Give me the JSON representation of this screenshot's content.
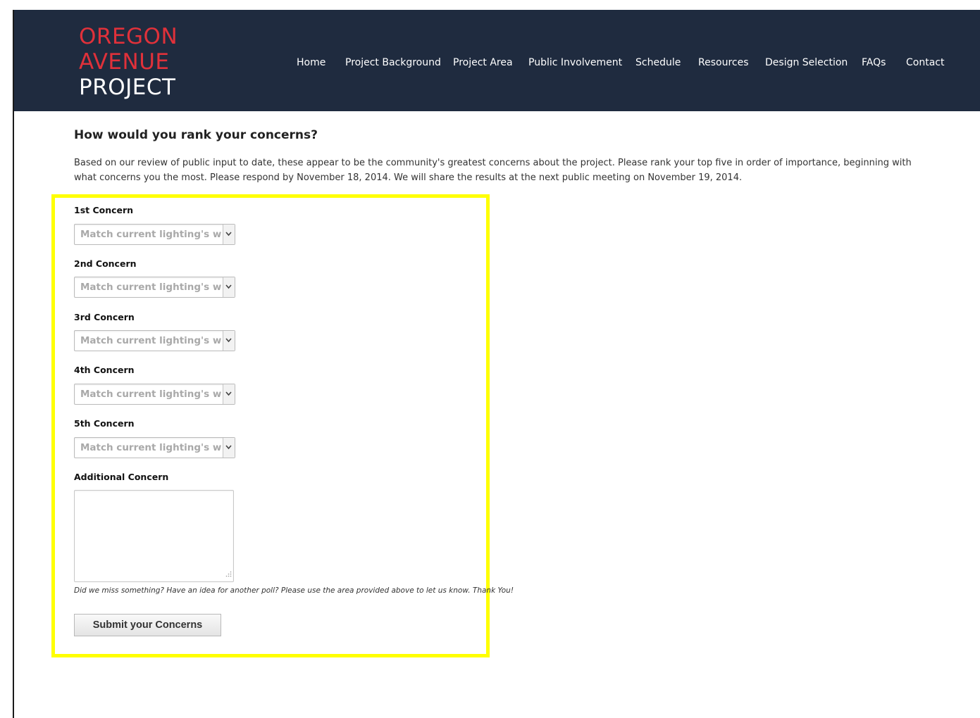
{
  "logo": {
    "line1": "OREGON",
    "line2": "AVENUE",
    "line3": "PROJECT"
  },
  "nav": {
    "items": [
      {
        "label": "Home"
      },
      {
        "label": "Project Background"
      },
      {
        "label": "Project Area"
      },
      {
        "label": "Public Involvement"
      },
      {
        "label": "Schedule"
      },
      {
        "label": "Resources"
      },
      {
        "label": "Design Selection"
      },
      {
        "label": "FAQs"
      },
      {
        "label": "Contact"
      }
    ]
  },
  "main": {
    "heading": "How would you rank your concerns?",
    "intro": "Based on our review of public input to date, these appear to be the community's greatest concerns about the project. Please rank your top five in order of importance, beginning with what concerns you the most. Please respond by November 18, 2014. We will share the results at the next public meeting on November 19, 2014."
  },
  "form": {
    "fields": [
      {
        "label": "1st Concern",
        "value": "Match current lighting's warmth"
      },
      {
        "label": "2nd Concern",
        "value": "Match current lighting's warmth"
      },
      {
        "label": "3rd Concern",
        "value": "Match current lighting's warmth"
      },
      {
        "label": "4th Concern",
        "value": "Match current lighting's warmth"
      },
      {
        "label": "5th Concern",
        "value": "Match current lighting's warmth"
      }
    ],
    "additional_label": "Additional Concern",
    "additional_value": "",
    "hint": "Did we miss something? Have an idea for another poll? Please use the area provided above to let us know. Thank You!",
    "submit_label": "Submit your Concerns"
  },
  "colors": {
    "header_bg": "#1f2b3f",
    "logo_red": "#e0313a",
    "highlight": "#ffff00"
  }
}
